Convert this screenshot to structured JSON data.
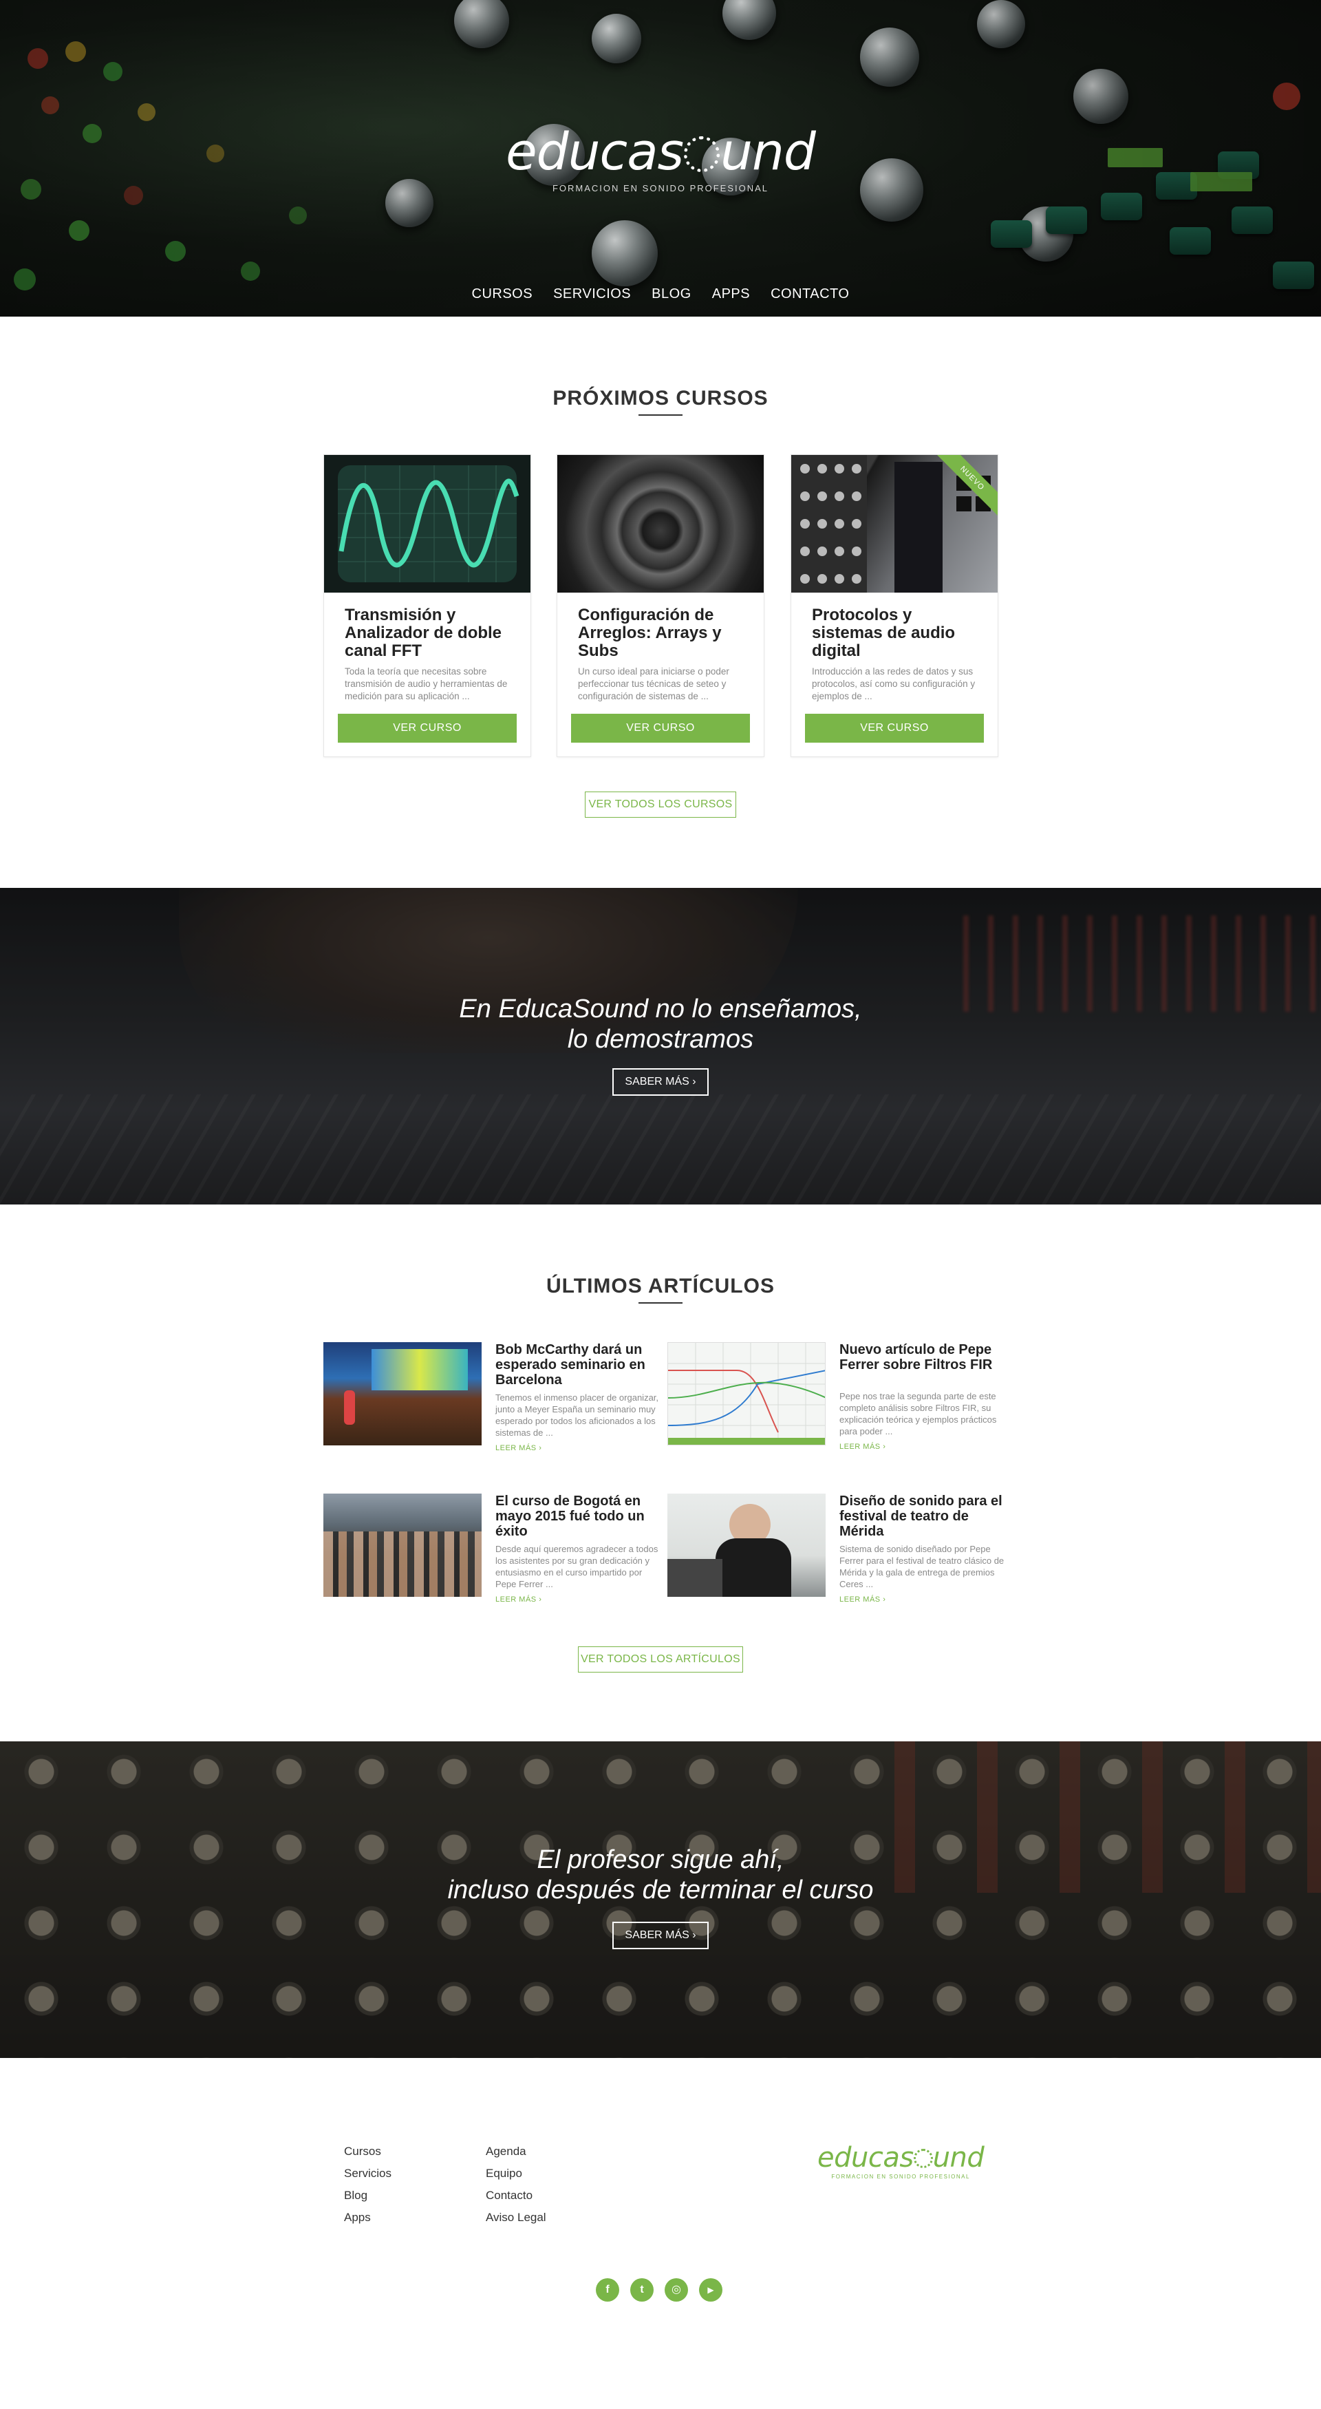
{
  "brand": {
    "name_prefix": "educas",
    "name_suffix": "und",
    "tagline": "FORMACION EN SONIDO PROFESIONAL",
    "accent_color": "#7ab648"
  },
  "nav": {
    "items": [
      "CURSOS",
      "SERVICIOS",
      "BLOG",
      "APPS",
      "CONTACTO"
    ]
  },
  "courses_section": {
    "title": "PRÓXIMOS CURSOS",
    "cards": [
      {
        "title": "Transmisión y Analizador de doble canal FFT",
        "excerpt": "Toda la teoría que necesitas sobre transmisión de audio y herramientas de medición para su aplicación ...",
        "button": "VER CURSO"
      },
      {
        "title": "Configuración de Arreglos: Arrays y Subs",
        "excerpt": "Un curso ideal para iniciarse o poder perfeccionar tus técnicas de seteo y configuración de sistemas de ...",
        "button": "VER CURSO"
      },
      {
        "title": "Protocolos y sistemas de audio digital",
        "excerpt": "Introducción a las redes de datos y sus protocolos, así como su configuración y ejemplos de ...",
        "button": "VER CURSO",
        "badge": "NUEVO"
      }
    ],
    "all_button": "VER TODOS LOS CURSOS"
  },
  "banner1": {
    "line1": "En EducaSound no lo enseñamos,",
    "line2": "lo demostramos",
    "button": "SABER MÁS"
  },
  "articles_section": {
    "title": "ÚLTIMOS ARTÍCULOS",
    "items": [
      {
        "title": "Bob McCarthy dará un esperado seminario en Barcelona",
        "excerpt": "Tenemos el inmenso placer de organizar, junto a Meyer España un seminario muy esperado por todos los aficionados a los sistemas de ...",
        "more": "LEER MÁS"
      },
      {
        "title": "Nuevo artículo de Pepe Ferrer sobre Filtros FIR",
        "excerpt": "Pepe nos trae la segunda parte de este completo análisis sobre Filtros FIR, su explicación teórica y ejemplos prácticos para poder ...",
        "more": "LEER MÁS"
      },
      {
        "title": "El curso de Bogotá en mayo 2015 fué todo un éxito",
        "excerpt": "Desde aquí queremos agradecer a todos los asistentes por su gran dedicación y entusiasmo en el curso impartido por Pepe Ferrer ...",
        "more": "LEER MÁS"
      },
      {
        "title": "Diseño de sonido para el festival de teatro de Mérida",
        "excerpt": "Sistema de sonido diseñado por Pepe Ferrer para el festival de teatro clásico de Mérida y la gala de entrega de premios Ceres ...",
        "more": "LEER MÁS"
      }
    ],
    "all_button": "VER TODOS LOS ARTÍCULOS"
  },
  "banner2": {
    "line1": "El profesor sigue ahí,",
    "line2": "incluso después de terminar el curso",
    "button": "SABER MÁS"
  },
  "footer": {
    "col1": [
      "Cursos",
      "Servicios",
      "Blog",
      "Apps"
    ],
    "col2": [
      "Agenda",
      "Equipo",
      "Contacto",
      "Aviso Legal"
    ],
    "social": [
      {
        "icon": "facebook-icon",
        "glyph": "f"
      },
      {
        "icon": "twitter-icon",
        "glyph": "t"
      },
      {
        "icon": "instagram-icon",
        "glyph": "◎"
      },
      {
        "icon": "youtube-icon",
        "glyph": "▶"
      }
    ]
  }
}
